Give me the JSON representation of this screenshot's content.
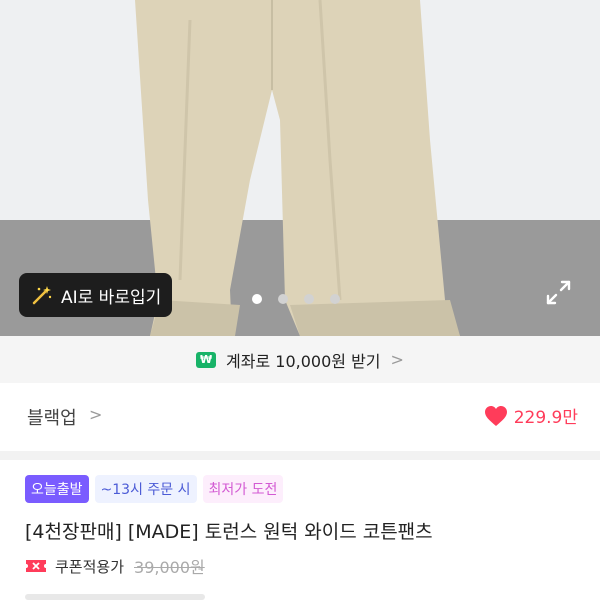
{
  "hero": {
    "ai_button_label": "AI로 바로입기",
    "carousel_dots": 4,
    "active_dot": 0
  },
  "bank_bar": {
    "badge": "₩",
    "text": "계좌로 10,000원 받기",
    "chevron": ">"
  },
  "store": {
    "name": "블랙업",
    "chevron": ">",
    "likes": "229.9만"
  },
  "badges": {
    "today": "오늘출발",
    "time": "~13시 주문 시",
    "lowest": "최저가 도전"
  },
  "product": {
    "title": "[4천장판매] [MADE] 토런스 원턱 와이드 코튼팬츠",
    "coupon_label": "쿠폰적용가",
    "original_price": "39,000원"
  },
  "colors": {
    "accent_purple": "#7a5cff",
    "like_red": "#ff3c5a",
    "bank_green": "#18b368"
  }
}
